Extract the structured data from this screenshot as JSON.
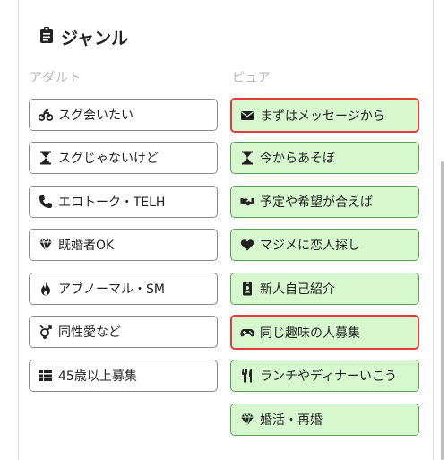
{
  "section": {
    "title": "ジャンル",
    "adult_heading": "アダルト",
    "pure_heading": "ピュア"
  },
  "adult": [
    {
      "label": "スグ会いたい",
      "icon": "motorcycle-icon"
    },
    {
      "label": "スグじゃないけど",
      "icon": "hourglass-icon"
    },
    {
      "label": "エロトーク・TELH",
      "icon": "phone-icon"
    },
    {
      "label": "既婚者OK",
      "icon": "diamond-icon"
    },
    {
      "label": "アブノーマル・SM",
      "icon": "fire-icon"
    },
    {
      "label": "同性愛など",
      "icon": "gender-icon"
    },
    {
      "label": "45歳以上募集",
      "icon": "list-icon"
    }
  ],
  "pure": [
    {
      "label": "まずはメッセージから",
      "icon": "envelope-icon",
      "selected": true
    },
    {
      "label": "今からあそぼ",
      "icon": "hourglass-icon",
      "selected": false
    },
    {
      "label": "予定や希望が合えば",
      "icon": "handshake-icon",
      "selected": false
    },
    {
      "label": "マジメに恋人探し",
      "icon": "heart-icon",
      "selected": false
    },
    {
      "label": "新人自己紹介",
      "icon": "id-card-icon",
      "selected": false
    },
    {
      "label": "同じ趣味の人募集",
      "icon": "gamepad-icon",
      "selected": true
    },
    {
      "label": "ランチやディナーいこう",
      "icon": "utensils-icon",
      "selected": false
    },
    {
      "label": "婚活・再婚",
      "icon": "diamond-icon",
      "selected": false
    }
  ],
  "colors": {
    "pure_bg": "#d7f8cf",
    "pure_border": "#5aa05a",
    "selected_border": "#e23b3b",
    "adult_border": "#8a8a8a",
    "heading_gray": "#b9b9b9"
  }
}
